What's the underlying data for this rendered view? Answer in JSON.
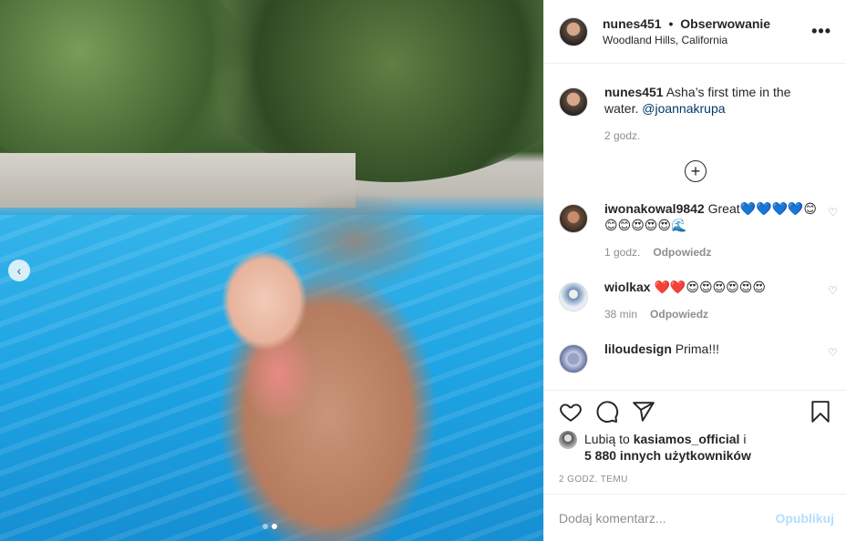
{
  "media": {
    "prev_glyph": "‹",
    "dots": [
      false,
      true
    ]
  },
  "header": {
    "username": "nunes451",
    "separator": "•",
    "follow_status": "Obserwowanie",
    "location": "Woodland Hills, California",
    "more_glyph": "•••"
  },
  "caption": {
    "username": "nunes451",
    "text": "Asha’s first time in the water.",
    "mention": "@joannakrupa",
    "time": "2 godz."
  },
  "load_more_glyph": "+",
  "comments": [
    {
      "username": "iwonakowal9842",
      "text": "Great💙💙💙💙😊😊😊😍😍😍🌊",
      "time": "1 godz.",
      "reply": "Odpowiedz"
    },
    {
      "username": "wiolkax",
      "text": "❤️❤️😍😍😍😍😍😍",
      "time": "38 min",
      "reply": "Odpowiedz"
    },
    {
      "username": "liloudesign",
      "text": "Prima!!!"
    }
  ],
  "heart_glyph": "♡",
  "likes": {
    "prefix": "Lubią to",
    "user": "kasiamos_official",
    "conj": "i",
    "others": "5 880 innych użytkowników"
  },
  "time_ago": "2 GODZ. TEMU",
  "composer": {
    "placeholder": "Dodaj komentarz...",
    "publish": "Opublikuj"
  }
}
